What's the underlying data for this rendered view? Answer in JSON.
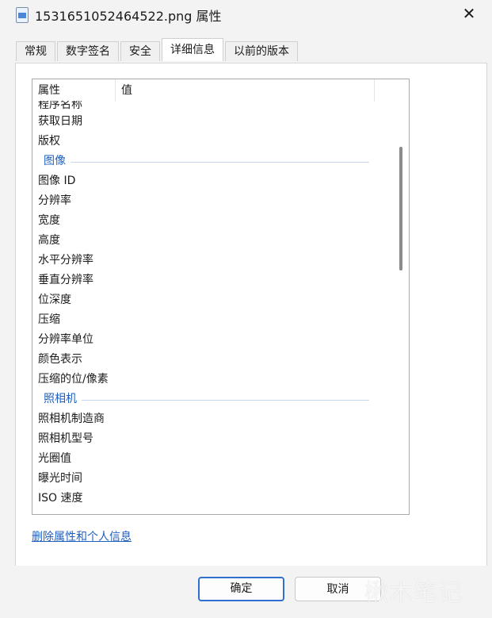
{
  "window": {
    "title": "1531651052464522.png 属性",
    "close_label": "✕"
  },
  "tabs": [
    {
      "label": "常规",
      "active": false
    },
    {
      "label": "数字签名",
      "active": false
    },
    {
      "label": "安全",
      "active": false
    },
    {
      "label": "详细信息",
      "active": true
    },
    {
      "label": "以前的版本",
      "active": false
    }
  ],
  "table": {
    "headers": {
      "name": "属性",
      "value": "值"
    },
    "partial_top": "程序名称",
    "rows": [
      {
        "type": "item",
        "name": "获取日期",
        "value": ""
      },
      {
        "type": "item",
        "name": "版权",
        "value": ""
      },
      {
        "type": "group",
        "name": "图像"
      },
      {
        "type": "item",
        "name": "图像 ID",
        "value": ""
      },
      {
        "type": "item",
        "name": "分辨率",
        "value": ""
      },
      {
        "type": "item",
        "name": "宽度",
        "value": ""
      },
      {
        "type": "item",
        "name": "高度",
        "value": ""
      },
      {
        "type": "item",
        "name": "水平分辨率",
        "value": ""
      },
      {
        "type": "item",
        "name": "垂直分辨率",
        "value": ""
      },
      {
        "type": "item",
        "name": "位深度",
        "value": ""
      },
      {
        "type": "item",
        "name": "压缩",
        "value": ""
      },
      {
        "type": "item",
        "name": "分辨率单位",
        "value": ""
      },
      {
        "type": "item",
        "name": "颜色表示",
        "value": ""
      },
      {
        "type": "item",
        "name": "压缩的位/像素",
        "value": ""
      },
      {
        "type": "group",
        "name": "照相机"
      },
      {
        "type": "item",
        "name": "照相机制造商",
        "value": ""
      },
      {
        "type": "item",
        "name": "照相机型号",
        "value": ""
      },
      {
        "type": "item",
        "name": "光圈值",
        "value": ""
      },
      {
        "type": "item",
        "name": "曝光时间",
        "value": ""
      },
      {
        "type": "item",
        "name": "ISO 速度",
        "value": ""
      }
    ]
  },
  "link": {
    "label": "删除属性和个人信息"
  },
  "buttons": {
    "ok": "确定",
    "cancel": "取消"
  },
  "watermark": {
    "text": "楸木笔记"
  },
  "colors": {
    "accent": "#2f6fd0",
    "group_text": "#1f5fbf"
  }
}
